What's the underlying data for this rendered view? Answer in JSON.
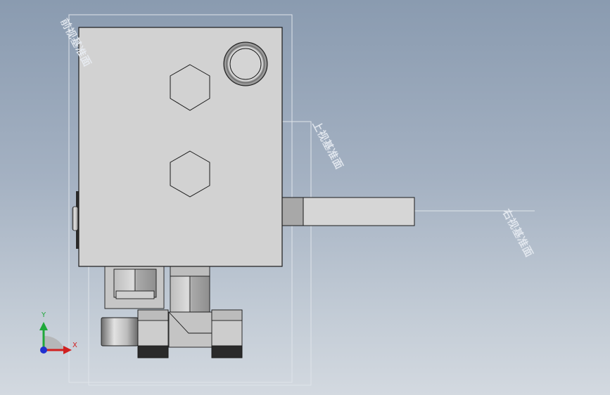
{
  "viewport": {
    "background_top": "#8a9bb0",
    "background_bottom": "#d3d9e0"
  },
  "reference_planes": {
    "front": "前视基准面",
    "top": "上视基准面",
    "right": "右视基准面"
  },
  "triad": {
    "y_label": "Y",
    "x_label": "X",
    "y_color": "#1fa83a",
    "x_color": "#d02020",
    "z_color": "#2030d0"
  },
  "model": {
    "body_color": "#d2d2d2",
    "edge_color": "#1a1a1a",
    "fitting_dark": "#2a2a2a",
    "icons": [
      "hex-port-icon",
      "o-ring-port-icon"
    ]
  }
}
